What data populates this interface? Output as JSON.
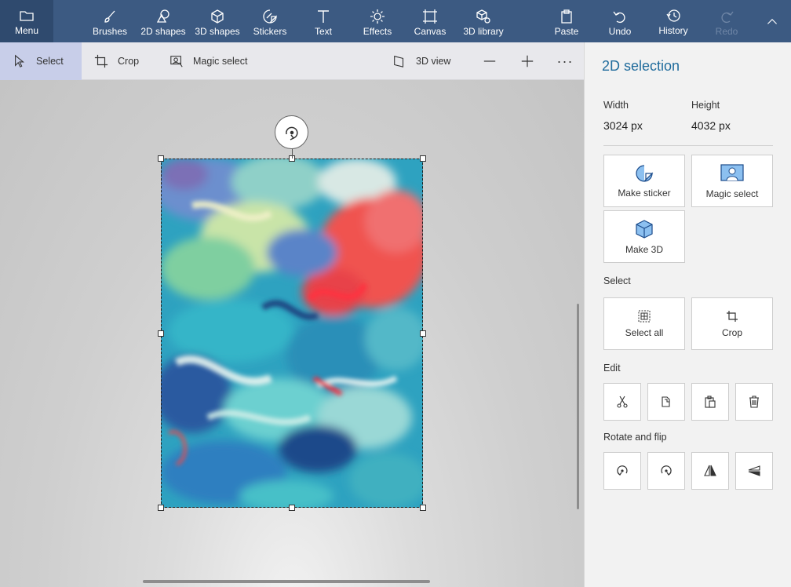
{
  "ribbon": {
    "menu": "Menu",
    "brushes": "Brushes",
    "shapes2d": "2D shapes",
    "shapes3d": "3D shapes",
    "stickers": "Stickers",
    "text": "Text",
    "effects": "Effects",
    "canvas": "Canvas",
    "library3d": "3D library",
    "paste": "Paste",
    "undo": "Undo",
    "history": "History",
    "redo": "Redo"
  },
  "toolbar": {
    "select": "Select",
    "crop": "Crop",
    "magic_select": "Magic select",
    "view3d": "3D view",
    "more": "···"
  },
  "panel": {
    "title": "2D selection",
    "width_label": "Width",
    "width_value": "3024 px",
    "height_label": "Height",
    "height_value": "4032 px",
    "make_sticker": "Make sticker",
    "magic_select": "Magic select",
    "make_3d": "Make 3D",
    "select_section": "Select",
    "select_all": "Select all",
    "crop": "Crop",
    "edit_section": "Edit",
    "rotate_section": "Rotate and flip"
  },
  "colors": {
    "ribbon_bg": "#3c5a82",
    "accent": "#1f6b9c",
    "selected_tool_bg": "#c8cee9"
  }
}
